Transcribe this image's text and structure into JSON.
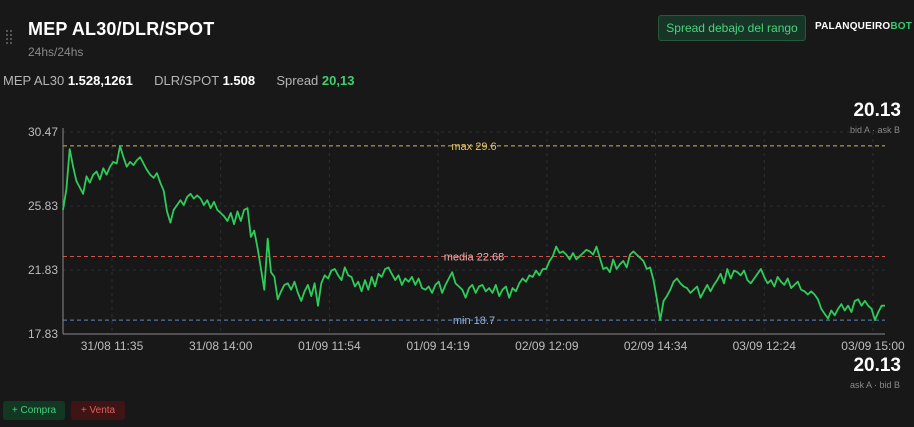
{
  "header": {
    "title": "MEP AL30/DLR/SPOT",
    "subtitle": "24hs/24hs",
    "status_badge": "Spread debajo del rango",
    "brand": {
      "part1": "PALANQUEIRO",
      "part2": "BOT"
    }
  },
  "stats": {
    "mep_label": "MEP AL30",
    "mep_value": "1.528,1261",
    "dlr_label": "DLR/SPOT",
    "dlr_value": "1.508",
    "spread_label": "Spread",
    "spread_value": "20,13"
  },
  "right_top": {
    "value": "20.13",
    "caption": "bid A · ask B"
  },
  "right_bottom": {
    "value": "20.13",
    "caption": "ask A · bid B"
  },
  "buttons": {
    "buy": "+ Compra",
    "sell": "+ Venta"
  },
  "icons": {
    "drag": "drag-handle-icon"
  },
  "colors": {
    "background": "#181818",
    "line": "#2ecc5a",
    "max": "#d4b257",
    "mean": "#d2514b",
    "min": "#5f87c2",
    "accent_green": "#3fcf6e"
  },
  "chart_data": {
    "type": "line",
    "title": "",
    "xlabel": "",
    "ylabel": "",
    "ylim": [
      17.83,
      30.47
    ],
    "y_ticks": [
      "30.47",
      "25.83",
      "21.83",
      "17.83"
    ],
    "x_ticks": [
      "31/08 11:35",
      "31/08 14:00",
      "01/09 11:54",
      "01/09 14:19",
      "02/09 12:09",
      "02/09 14:34",
      "03/09 12:24",
      "03/09 15:00"
    ],
    "reference_lines": [
      {
        "label": "max 29.6",
        "value": 29.6
      },
      {
        "label": "media 22.68",
        "value": 22.68
      },
      {
        "label": "min 18.7",
        "value": 18.7
      }
    ],
    "grid": true,
    "series": [
      {
        "values": [
          25.6,
          26.9,
          29.4,
          28.3,
          27.4,
          27.0,
          26.6,
          27.7,
          27.3,
          27.8,
          28.0,
          27.5,
          28.2,
          27.8,
          28.3,
          28.6,
          28.5,
          29.6,
          28.9,
          28.3,
          28.6,
          28.4,
          28.7,
          28.9,
          28.5,
          28.1,
          27.8,
          27.6,
          27.9,
          27.3,
          26.8,
          25.5,
          24.8,
          25.6,
          25.9,
          26.2,
          25.9,
          26.4,
          26.6,
          26.3,
          26.5,
          26.3,
          25.9,
          26.2,
          25.7,
          26.1,
          25.6,
          25.4,
          25.2,
          24.9,
          25.4,
          24.7,
          25.5,
          24.9,
          25.6,
          25.7,
          23.9,
          24.3,
          23.2,
          21.9,
          20.6,
          23.8,
          21.7,
          21.4,
          20.0,
          20.5,
          20.9,
          21.0,
          20.6,
          21.1,
          20.4,
          19.9,
          20.5,
          20.9,
          20.2,
          21.0,
          19.6,
          21.0,
          21.5,
          21.3,
          21.8,
          21.9,
          21.5,
          21.2,
          22.0,
          21.5,
          21.4,
          20.8,
          21.1,
          20.5,
          21.2,
          20.6,
          21.4,
          20.8,
          21.6,
          21.4,
          21.9,
          22.0,
          21.6,
          21.2,
          21.5,
          20.9,
          21.3,
          21.1,
          21.4,
          20.9,
          21.3,
          20.7,
          20.6,
          20.8,
          20.4,
          20.9,
          21.1,
          20.4,
          20.9,
          21.3,
          21.7,
          21.0,
          20.8,
          20.6,
          20.1,
          20.7,
          20.9,
          20.4,
          20.8,
          20.9,
          20.5,
          20.7,
          20.4,
          20.9,
          20.2,
          20.6,
          20.8,
          20.1,
          20.7,
          20.5,
          21.0,
          21.3,
          21.1,
          21.5,
          21.4,
          21.8,
          21.5,
          21.9,
          21.9,
          22.4,
          22.7,
          23.3,
          22.9,
          23.0,
          22.8,
          22.5,
          22.9,
          22.5,
          22.7,
          22.9,
          23.1,
          23.0,
          22.8,
          23.3,
          22.6,
          21.9,
          22.0,
          21.7,
          22.5,
          21.9,
          22.2,
          22.4,
          22.0,
          22.8,
          23.0,
          22.8,
          22.6,
          22.4,
          21.9,
          22.0,
          21.2,
          20.0,
          18.7,
          19.9,
          20.2,
          20.6,
          21.1,
          21.3,
          21.0,
          20.8,
          20.7,
          20.4,
          20.6,
          20.8,
          20.1,
          20.5,
          20.9,
          20.5,
          20.9,
          21.2,
          21.6,
          21.0,
          21.9,
          21.3,
          21.8,
          21.7,
          21.5,
          21.8,
          21.2,
          21.0,
          21.3,
          21.6,
          21.9,
          21.4,
          21.0,
          21.2,
          20.8,
          21.4,
          21.1,
          20.9,
          21.3,
          20.7,
          20.9,
          21.1,
          20.6,
          20.5,
          20.3,
          20.5,
          20.3,
          20.0,
          19.4,
          19.1,
          18.8,
          19.3,
          19.0,
          19.4,
          19.7,
          19.3,
          19.6,
          19.2,
          19.9,
          20.0,
          19.6,
          19.9,
          19.6,
          19.4,
          18.7,
          19.2,
          19.6,
          19.6
        ]
      }
    ]
  }
}
